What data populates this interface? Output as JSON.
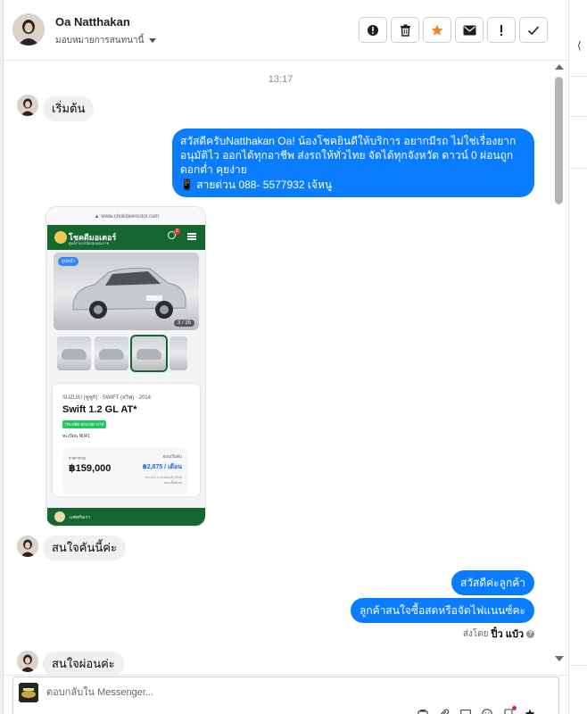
{
  "header": {
    "contact_name": "Oa Natthakan",
    "assign_label": "มอบหมายการสนทนานี้",
    "actions": [
      {
        "name": "report-icon",
        "label": "!"
      },
      {
        "name": "trash-icon",
        "label": ""
      },
      {
        "name": "star-icon",
        "label": ""
      },
      {
        "name": "mail-icon",
        "label": ""
      },
      {
        "name": "alert-icon",
        "label": "!"
      },
      {
        "name": "check-icon",
        "label": ""
      }
    ],
    "accent_star_color": "#f5821f"
  },
  "chat": {
    "timestamp": "13:17",
    "messages": {
      "m1": "เริ่มต้น",
      "m2_lines": [
        "สวัสดีครับNatthakan Oa! น้องโชคยินดีให้บริการ อยากมีรถ ไม่ใช่เรื่องยาก",
        "อนุมัติไว ออกได้ทุกอาชีพ ส่งรถให้ทั่วไทย จัดได้ทุกจังหวัด ดาวน์ 0  ผ่อนถูก",
        "ดอกต่ำ คุยง่าย",
        "📱 สายด่วน 088- 5577932 เจ้หนู"
      ],
      "m3": "สนใจคันนี้ค่ะ",
      "m4": "สวัสดีค่ะลูกค้า",
      "m5": "ลูกค้าสนใจซื้อสดหรือจัดไฟแนนซ์คะ",
      "m6": "สนใจผ่อนค่ะ"
    },
    "sent_by_prefix": "ส่งโดย",
    "sent_by_name": "ปิ๋ว แป๋ว",
    "outgoing_color": "#0a7cff"
  },
  "attachment": {
    "url_text": "▲ www.chokdeemotor.com",
    "brand": "โชคดีมอเตอร์",
    "brand_sub": "ศูนย์รวมรถมือสองคุณภาพ",
    "badge": "2",
    "photo_tag": "รูปหน้า",
    "photo_count": "3 / 35",
    "make": "SUZUKI (ซูซูกิ)  ·  SWIFT (สวิฟ)  ·  2014",
    "model": "Swift 1.2 GL AT*",
    "promo": "ประหยัด 570,000 บาท",
    "stock": "ทะเบียน N041",
    "price_label": "ราคาขาย",
    "price": "฿159,000",
    "monthly_label": "ผ่อนเริ่มต้น",
    "monthly": "฿2,875 / เดือน",
    "monthly_note": "*ดาวน์ 0 บาท ผ่อน 84 เดือน ดอกเบี้ยพิเศษ",
    "footer_text": "แชทกับเรา"
  },
  "composer": {
    "placeholder": "ตอบกลับใน Messenger...",
    "tools": [
      "sticker-icon",
      "attach-icon",
      "image-icon",
      "emoji-icon",
      "saved-reply-icon",
      "pin-icon"
    ]
  }
}
